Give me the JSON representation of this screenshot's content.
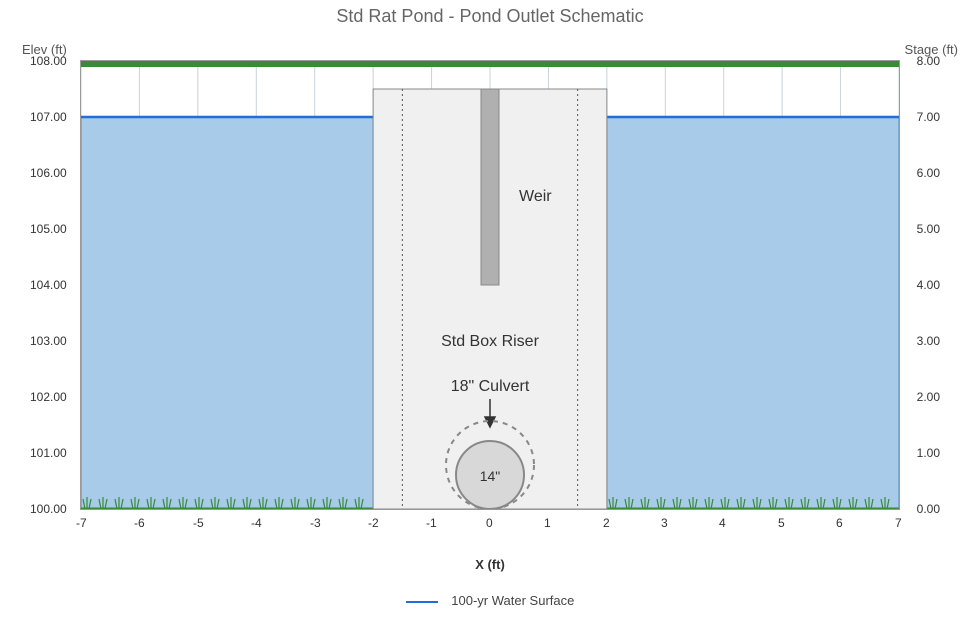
{
  "chart_data": {
    "type": "diagram",
    "title": "Std Rat Pond - Pond Outlet Schematic",
    "xlabel": "X (ft)",
    "ylabel_left": "Elev (ft)",
    "ylabel_right": "Stage (ft)",
    "x_ticks": [
      -7,
      -6,
      -5,
      -4,
      -3,
      -2,
      -1,
      0,
      1,
      2,
      3,
      4,
      5,
      6,
      7
    ],
    "y_left_ticks": [
      "100.00",
      "101.00",
      "102.00",
      "103.00",
      "104.00",
      "105.00",
      "106.00",
      "107.00",
      "108.00"
    ],
    "y_right_ticks": [
      "0.00",
      "1.00",
      "2.00",
      "3.00",
      "4.00",
      "5.00",
      "6.00",
      "7.00",
      "8.00"
    ],
    "x_range": [
      -7,
      7
    ],
    "elev_range": [
      100,
      108
    ],
    "stage_range": [
      0,
      8
    ],
    "water_surface_elev": 107.0,
    "water_surface_stage": 7.0,
    "ground_elev": 100.0,
    "embankment_top_elev": 108.0,
    "riser": {
      "left_x": -2.0,
      "right_x": 2.0,
      "inner_left_x": -1.5,
      "inner_right_x": 1.5,
      "top_elev": 107.5,
      "label": "Std Box Riser"
    },
    "weir": {
      "x": 0.0,
      "crest_elev": 104.0,
      "label": "Weir"
    },
    "culvert": {
      "diameter_in": 18,
      "label": "18\" Culvert",
      "annotation": "14\""
    },
    "legend": {
      "items": [
        {
          "label": "100-yr Water Surface",
          "color": "#1e6fd9"
        }
      ]
    }
  }
}
